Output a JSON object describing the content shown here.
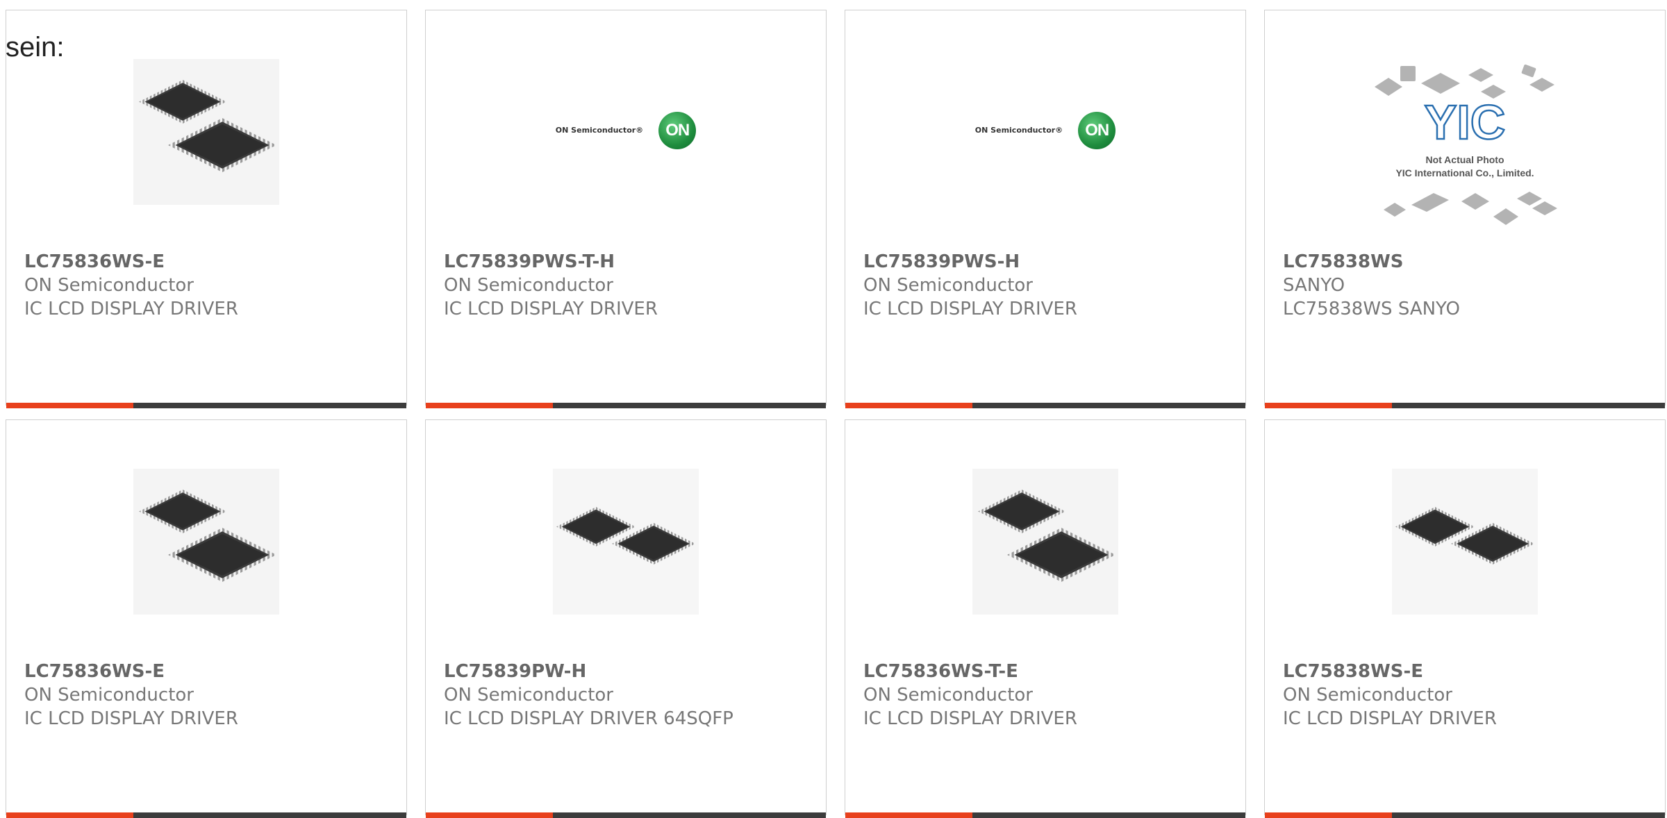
{
  "intro_text": "sein:",
  "products": [
    {
      "part": "LC75836WS-E",
      "manufacturer": "ON Semiconductor",
      "description": "IC LCD DISPLAY DRIVER",
      "image": "qfp-chip-photo"
    },
    {
      "part": "LC75839PWS-T-H",
      "manufacturer": "ON Semiconductor",
      "description": "IC LCD DISPLAY DRIVER",
      "image": "on-semiconductor-logo"
    },
    {
      "part": "LC75839PWS-H",
      "manufacturer": "ON Semiconductor",
      "description": "IC LCD DISPLAY DRIVER",
      "image": "on-semiconductor-logo"
    },
    {
      "part": "LC75838WS",
      "manufacturer": "SANYO",
      "description": "LC75838WS SANYO",
      "image": "yic-placeholder"
    },
    {
      "part": "LC75836WS-E",
      "manufacturer": "ON Semiconductor",
      "description": "IC LCD DISPLAY DRIVER",
      "image": "qfp-chip-photo"
    },
    {
      "part": "LC75839PW-H",
      "manufacturer": "ON Semiconductor",
      "description": "IC LCD DISPLAY DRIVER 64SQFP",
      "image": "qfp-chip-photo-small"
    },
    {
      "part": "LC75836WS-T-E",
      "manufacturer": "ON Semiconductor",
      "description": "IC LCD DISPLAY DRIVER",
      "image": "qfp-chip-photo"
    },
    {
      "part": "LC75838WS-E",
      "manufacturer": "ON Semiconductor",
      "description": "IC LCD DISPLAY DRIVER",
      "image": "qfp-chip-photo-small"
    }
  ],
  "logos": {
    "on_text": "ON Semiconductor®",
    "on_badge": "ON",
    "yic_mark": "YIC",
    "yic_line1": "Not Actual Photo",
    "yic_line2": "YIC International Co., Limited."
  },
  "colors": {
    "accent": "#e8401c",
    "bar": "#3c3c3c",
    "text": "#777777",
    "on_green": "#1f8d3e",
    "yic_blue": "#2a6fb0"
  }
}
